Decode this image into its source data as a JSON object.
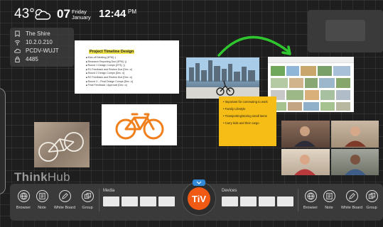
{
  "header": {
    "temperature": "43°",
    "weather_icon": "partly-cloudy-icon",
    "date_day": "07",
    "weekday": "Friday",
    "month": "January",
    "time": "12:44",
    "ampm": "PM"
  },
  "info": {
    "location": "The Shire",
    "ip": "10.2.0.210",
    "device_code": "PCDV-WUJT",
    "pin": "4485"
  },
  "document": {
    "title": "Project Timeline Design",
    "items": [
      "Kick-off Meeting [4PM] :)",
      "Research Reporting Due [4PM] :))",
      "Round 1 Design Comps [2TS] :))",
      "R1 Feedback and Review Due [Dec :o]",
      "Round 2 Design Comps [Dec :o]",
      "R2 Feedback and Review Due [Dec :o]",
      "Round 3 – Final Design Comps [Dec :o]",
      "Final Feedback / Approval [Dec :o]"
    ]
  },
  "sticky": {
    "items": [
      "Important for commuting to work",
      "Family Lifestyle",
      "Transporting/storing small items",
      "Carry kids and their cargo"
    ]
  },
  "brand": {
    "think": "Think",
    "hub": "Hub",
    "logo_text": "TiV"
  },
  "toolbar": {
    "left_tools": [
      "Browser",
      "Note",
      "White Board",
      "Group"
    ],
    "right_tools": [
      "Browser",
      "Note",
      "White Board",
      "Group"
    ],
    "media_label": "Media",
    "devices_label": "Devices"
  },
  "colors": {
    "accent": "#f05a14",
    "sticky": "#f6bd17",
    "arrow": "#2fc52f",
    "tab": "#2f89d7"
  }
}
